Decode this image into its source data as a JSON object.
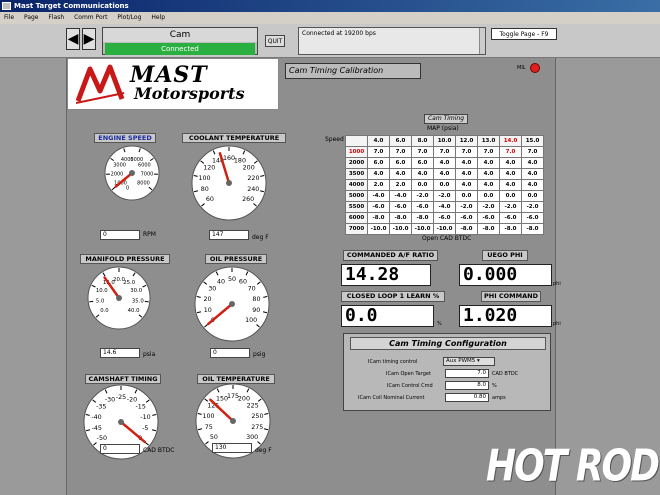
{
  "window": {
    "title": "Mast Target Communications"
  },
  "menu": [
    "File",
    "Page",
    "Flash",
    "Comm Port",
    "Plot/Log",
    "Help"
  ],
  "toolbar": {
    "page_name": "Cam",
    "connection": "Connected",
    "quit": "QUIT",
    "status": "Connected at 19200 bps",
    "toggle": "Toggle Page - F9"
  },
  "logo": {
    "line1": "MAST",
    "line2": "Motorsports"
  },
  "page_title": "Cam Timing Calibration",
  "mil_label": "MIL",
  "gauges": [
    {
      "label": "ENGINE SPEED",
      "value": "0",
      "unit": "RPM",
      "ticks": [
        "1000",
        "2000",
        "3000",
        "4000",
        "5000",
        "6000",
        "7000",
        "8000",
        "0"
      ],
      "needle": 0
    },
    {
      "label": "COOLANT TEMPERATURE",
      "value": "147",
      "unit": "deg F",
      "ticks": [
        "60",
        "80",
        "100",
        "120",
        "140",
        "160",
        "180",
        "200",
        "220",
        "240",
        "260"
      ],
      "needle": 147
    },
    {
      "label": "MANIFOLD PRESSURE",
      "value": "14.6",
      "unit": "psia",
      "ticks": [
        "0.0",
        "5.0",
        "10.0",
        "15.0",
        "20.0",
        "25.0",
        "30.0",
        "35.0",
        "40.0"
      ],
      "needle": 14.6
    },
    {
      "label": "OIL PRESSURE",
      "value": "0",
      "unit": "psig",
      "ticks": [
        "0",
        "10",
        "20",
        "30",
        "40",
        "50",
        "60",
        "70",
        "80",
        "90",
        "100"
      ],
      "needle": 0
    },
    {
      "label": "CAMSHAFT TIMING",
      "value": "0",
      "unit": "CAD BTDC",
      "ticks": [
        "-50",
        "-45",
        "-40",
        "-35",
        "-30",
        "-25",
        "-20",
        "-15",
        "-10",
        "-5",
        "0"
      ],
      "needle": 0
    },
    {
      "label": "OIL TEMPERATURE",
      "value": "130",
      "unit": "deg F",
      "ticks": [
        "50",
        "75",
        "100",
        "125",
        "150",
        "175",
        "200",
        "225",
        "250",
        "275",
        "300"
      ],
      "needle": 130
    }
  ],
  "cam_table": {
    "title": "Cam Timing",
    "map_label": "MAP (psia)",
    "speed_label": "Speed (rpm)",
    "footer": "Open CAD BTDC",
    "map_values": [
      "4.0",
      "6.0",
      "8.0",
      "10.0",
      "12.0",
      "13.0",
      "14.0",
      "15.0"
    ],
    "rows": [
      {
        "rpm": "1000",
        "values": [
          "7.0",
          "7.0",
          "7.0",
          "7.0",
          "7.0",
          "7.0",
          "7.0",
          "7.0"
        ]
      },
      {
        "rpm": "2000",
        "values": [
          "6.0",
          "6.0",
          "6.0",
          "4.0",
          "4.0",
          "4.0",
          "4.0",
          "4.0"
        ]
      },
      {
        "rpm": "3500",
        "values": [
          "4.0",
          "4.0",
          "4.0",
          "4.0",
          "4.0",
          "4.0",
          "4.0",
          "4.0"
        ]
      },
      {
        "rpm": "4000",
        "values": [
          "2.0",
          "2.0",
          "0.0",
          "0.0",
          "4.0",
          "4.0",
          "4.0",
          "4.0"
        ]
      },
      {
        "rpm": "5000",
        "values": [
          "-4.0",
          "-4.0",
          "-2.0",
          "-2.0",
          "0.0",
          "0.0",
          "0.0",
          "0.0"
        ]
      },
      {
        "rpm": "5500",
        "values": [
          "-6.0",
          "-6.0",
          "-6.0",
          "-4.0",
          "-2.0",
          "-2.0",
          "-2.0",
          "-2.0"
        ]
      },
      {
        "rpm": "6000",
        "values": [
          "-8.0",
          "-8.0",
          "-8.0",
          "-6.0",
          "-6.0",
          "-6.0",
          "-6.0",
          "-6.0"
        ]
      },
      {
        "rpm": "7000",
        "values": [
          "-10.0",
          "-10.0",
          "-10.0",
          "-10.0",
          "-8.0",
          "-8.0",
          "-8.0",
          "-8.0"
        ]
      }
    ]
  },
  "readouts": {
    "commanded_af": {
      "label": "COMMANDED A/F RATIO",
      "value": "14.28"
    },
    "uego_phi": {
      "label": "UEGO PHI",
      "value": "0.000",
      "unit": "phi"
    },
    "closed_loop": {
      "label": "CLOSED LOOP 1 LEARN %",
      "value": "0.0",
      "unit": "%"
    },
    "phi_command": {
      "label": "PHI COMMAND",
      "value": "1.020",
      "unit": "phi"
    }
  },
  "config": {
    "title": "Cam Timing Configuration",
    "rows": [
      {
        "label": "ICam timing control",
        "value": "Aux PWM5",
        "unit": ""
      },
      {
        "label": "ICam Open Target",
        "value": "7.0",
        "unit": "CAD BTDC"
      },
      {
        "label": "ICam Control Cmd",
        "value": "8.0",
        "unit": "%"
      },
      {
        "label": "ICam Coil Nominal Current",
        "value": "0.80",
        "unit": "amps"
      }
    ]
  },
  "watermark": "HOT ROD",
  "colors": {
    "connected": "#2ab040",
    "needle": "#d02010",
    "mil": "#e02020",
    "title_bar": "#0a246a"
  }
}
